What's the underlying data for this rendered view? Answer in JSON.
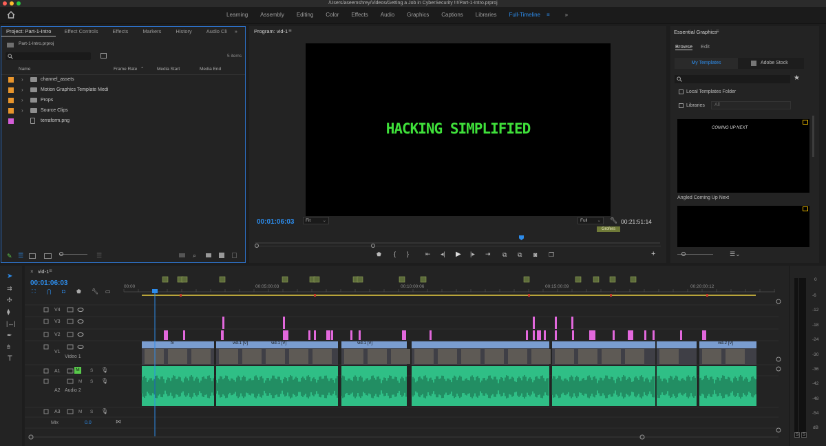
{
  "window": {
    "title": "/Users/aseemshrey/Videos/Getting a Job in CyberSecurity !!!/Part-1-Intro.prproj",
    "traffic_colors": [
      "#fe5f57",
      "#febc2e",
      "#28c840"
    ]
  },
  "workspaces": {
    "items": [
      "Learning",
      "Assembly",
      "Editing",
      "Color",
      "Effects",
      "Audio",
      "Graphics",
      "Captions",
      "Libraries",
      "Full-Timeline"
    ],
    "active": "Full-Timeline",
    "accent": "#2d8ceb"
  },
  "project": {
    "tabs": [
      "Project: Part-1-Intro",
      "Effect Controls",
      "Effects",
      "Markers",
      "History",
      "Audio Cli"
    ],
    "file": "Part-1-Intro.prproj",
    "count": "5 items",
    "columns": [
      "Name",
      "Frame Rate",
      "Media Start",
      "Media End"
    ],
    "items": [
      {
        "label": "channel_assets",
        "kind": "folder",
        "color": "#e8952c"
      },
      {
        "label": "Motion Graphics Template Medi",
        "kind": "folder",
        "color": "#e8952c"
      },
      {
        "label": "Props",
        "kind": "folder",
        "color": "#e8952c"
      },
      {
        "label": "Source Clips",
        "kind": "folder",
        "color": "#e8952c"
      },
      {
        "label": "terraform.png",
        "kind": "image",
        "color": "#d35dd7"
      }
    ]
  },
  "program": {
    "title": "Program: vid-1",
    "overlay_text": "HACKING SIMPLIFIED",
    "overlay_color": "#3fe03a",
    "timecode": "00:01:06:03",
    "fit": "Fit",
    "quality": "Full",
    "duration": "00:21:51:14",
    "marker_label": "Grofers"
  },
  "essential": {
    "title": "Essential Graphics",
    "tabs": [
      "Browse",
      "Edit"
    ],
    "source_tabs": [
      "My Templates",
      "Adobe Stock"
    ],
    "local_folder": "Local Templates Folder",
    "libraries": "Libraries",
    "libraries_value": "All",
    "template1_caption": "Angled Coming Up Next",
    "template1_preview": "COMING UP NEXT"
  },
  "timeline": {
    "sequence": "vid-1",
    "timecode": "00:01:06:03",
    "ruler": [
      "00:00",
      "00:05:00:03",
      "00:10:00:06",
      "00:15:00:09",
      "00:20:00:12"
    ],
    "tracks": [
      {
        "id": "V4"
      },
      {
        "id": "V3"
      },
      {
        "id": "V2"
      },
      {
        "id": "V1",
        "name": "Video 1"
      },
      {
        "id": "A1"
      },
      {
        "id": "A2",
        "name": "Audio 2"
      },
      {
        "id": "A3"
      }
    ],
    "mix_label": "Mix",
    "mix_value": "0.0",
    "clip_label": "vid-1 [V]",
    "clip_label2": "vid-2 [V]",
    "fx": "fx",
    "m": "M",
    "s": "S"
  },
  "meter": {
    "scale": [
      "0",
      "-6",
      "-12",
      "-18",
      "-24",
      "-30",
      "-36",
      "-42",
      "-48",
      "-54",
      "dB"
    ],
    "solo": [
      "S",
      "S"
    ]
  },
  "colors": {
    "video_clip": "#7a9dd0",
    "audio_clip": "#2fbf86",
    "marker": "#e268dc",
    "playhead": "#2d8ceb"
  }
}
